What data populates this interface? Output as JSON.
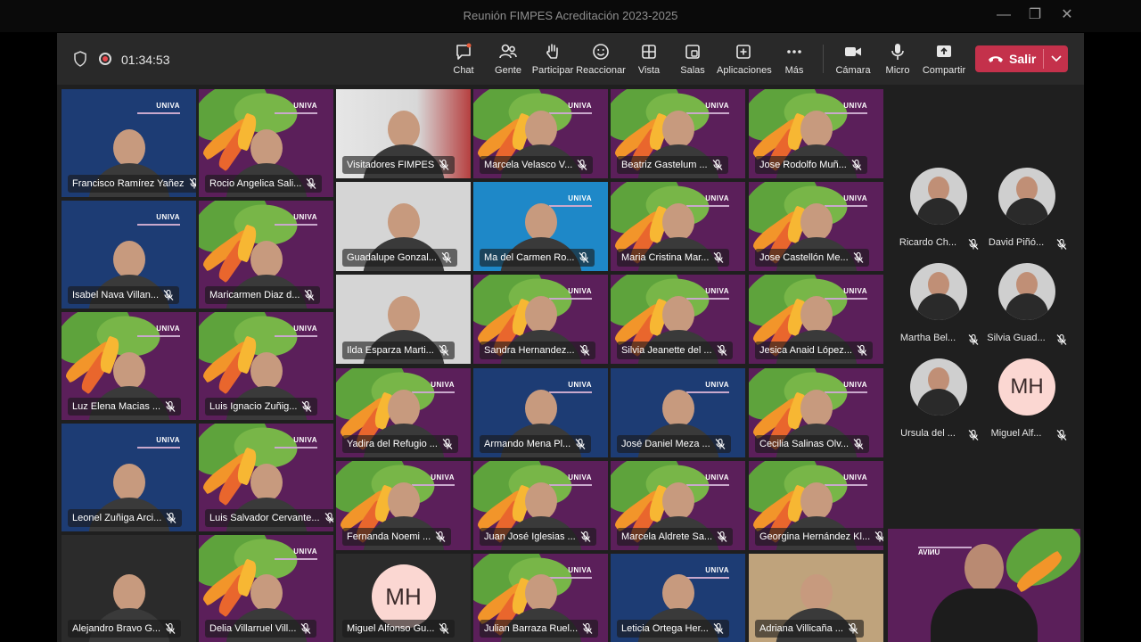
{
  "window": {
    "title": "Reunión FIMPES Acreditación 2023-2025"
  },
  "toolbar": {
    "timer": "01:34:53",
    "buttons": [
      {
        "id": "chat",
        "label": "Chat"
      },
      {
        "id": "people",
        "label": "Gente"
      },
      {
        "id": "raise",
        "label": "Participar"
      },
      {
        "id": "react",
        "label": "Reaccionar"
      },
      {
        "id": "view",
        "label": "Vista"
      },
      {
        "id": "rooms",
        "label": "Salas"
      },
      {
        "id": "apps",
        "label": "Aplicaciones"
      },
      {
        "id": "more",
        "label": "Más"
      },
      {
        "id": "camera",
        "label": "Cámara"
      },
      {
        "id": "mic",
        "label": "Micro"
      },
      {
        "id": "share",
        "label": "Compartir"
      }
    ],
    "leave_label": "Salir"
  },
  "brand_text": "UNIVA",
  "grid": [
    {
      "name": "Francisco Ramírez Yañez",
      "bg": "blue"
    },
    {
      "name": "Rocio Angelica Sali...",
      "bg": "purple"
    },
    {
      "name": "Visitadores FIMPES",
      "bg": "office"
    },
    {
      "name": "Marcela Velasco V...",
      "bg": "purple"
    },
    {
      "name": "Beatriz Gastelum ...",
      "bg": "purple"
    },
    {
      "name": "Jose Rodolfo Muñ...",
      "bg": "purple"
    },
    {
      "name": "Isabel Nava Villan...",
      "bg": "blue"
    },
    {
      "name": "Maricarmen Diaz d...",
      "bg": "purple"
    },
    {
      "name": "Guadalupe Gonzal...",
      "bg": "lightgray"
    },
    {
      "name": "Ma del Carmen Ro...",
      "bg": "cyan"
    },
    {
      "name": "Maria Cristina Mar...",
      "bg": "purple"
    },
    {
      "name": "Jose Castellón Me...",
      "bg": "purple"
    },
    {
      "name": "Luz Elena Macias ...",
      "bg": "purple"
    },
    {
      "name": "Luis Ignacio Zuñig...",
      "bg": "purple"
    },
    {
      "name": "Ilda Esparza Marti...",
      "bg": "lightgray"
    },
    {
      "name": "Sandra Hernandez...",
      "bg": "purple"
    },
    {
      "name": "Silvia Jeanette del ...",
      "bg": "purple"
    },
    {
      "name": "Jesica Anaid López...",
      "bg": "purple"
    },
    {
      "name": "Leonel Zuñiga Arci...",
      "bg": "blue"
    },
    {
      "name": "Luis Salvador Cervante...",
      "bg": "purple"
    },
    {
      "name": "Yadira del Refugio ...",
      "bg": "purple"
    },
    {
      "name": "Armando Mena Pl...",
      "bg": "blue"
    },
    {
      "name": "José Daniel Meza ...",
      "bg": "blue"
    },
    {
      "name": "Cecilia Salinas Olv...",
      "bg": "purple"
    },
    {
      "name": "Alejandro Bravo G...",
      "bg": "dark"
    },
    {
      "name": "Delia Villarruel Vill...",
      "bg": "purple"
    },
    {
      "name": "Fernanda Noemi ...",
      "bg": "purple"
    },
    {
      "name": "Juan José Iglesias ...",
      "bg": "purple"
    },
    {
      "name": "Marcela Aldrete Sa...",
      "bg": "purple"
    },
    {
      "name": "Georgina Hernández Kl...",
      "bg": "purple",
      "active": true
    },
    {
      "name": "Miguel Alfonso Gu...",
      "bg": "dark",
      "initials": "MH"
    },
    {
      "name": "Julian Barraza Ruel...",
      "bg": "purple"
    },
    {
      "name": "Leticia Ortega Her...",
      "bg": "blue"
    },
    {
      "name": "Adriana Villicaña ...",
      "bg": "beige"
    }
  ],
  "roster": [
    {
      "name": "Ricardo Ch..."
    },
    {
      "name": "David Piñó..."
    },
    {
      "name": "Martha Bel..."
    },
    {
      "name": "Silvia Guad..."
    },
    {
      "name": "Ursula del ..."
    },
    {
      "name": "Miguel Alf...",
      "initials": "MH"
    }
  ],
  "colors": {
    "leave": "#c4314b",
    "active_outline": "#7f85f5",
    "brand_purple": "#5b1f5a"
  }
}
